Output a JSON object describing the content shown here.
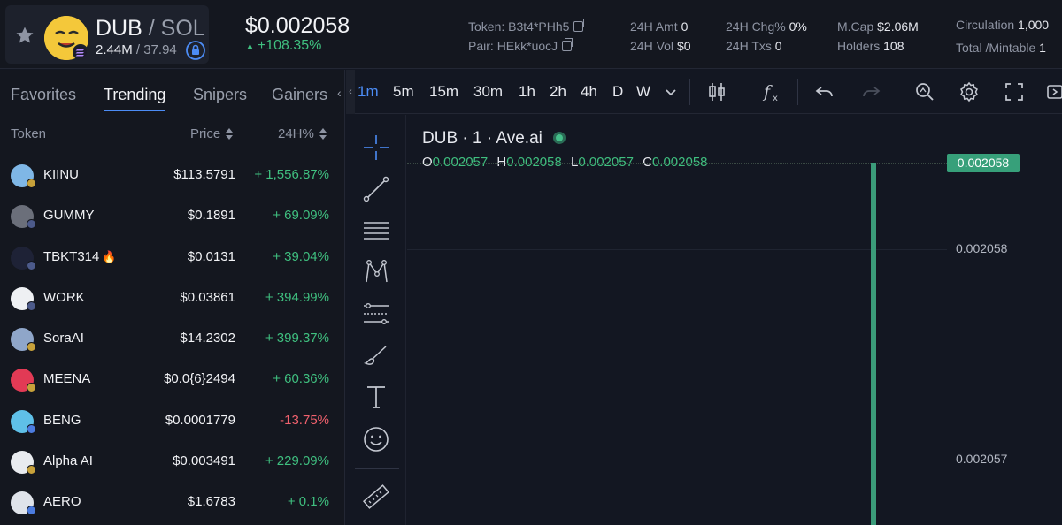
{
  "header": {
    "pair_base": "DUB",
    "pair_sep": " / ",
    "pair_quote": "SOL",
    "liquidity": "2.44M",
    "liquidity_sep": " / ",
    "liquidity_sol": "37.94",
    "price": "$0.002058",
    "change": "+108.35%",
    "token_label": "Token",
    "token_value": "B3t4*PHh5",
    "pair_label": "Pair",
    "pair_value": "HEkk*uocJ",
    "amt_label": "24H Amt",
    "amt_value": "0",
    "vol_label": "24H Vol",
    "vol_value": "$0",
    "chg_label": "24H Chg%",
    "chg_value": "0%",
    "txs_label": "24H Txs",
    "txs_value": "0",
    "mcap_label": "M.Cap",
    "mcap_value": "$2.06M",
    "holders_label": "Holders",
    "holders_value": "108",
    "circ_label": "Circulation",
    "circ_value": "1,000",
    "total_label": "Total /Mintable",
    "total_value": "1",
    "accent": "#3fbf7f"
  },
  "sidebar": {
    "tabs": [
      "Favorites",
      "Trending",
      "Snipers",
      "Gainers"
    ],
    "active_tab": "Trending",
    "columns": {
      "token": "Token",
      "price": "Price",
      "change": "24H%"
    },
    "tokens": [
      {
        "symbol": "KIINU",
        "price": "$113.5791",
        "change": "+ 1,556.87%",
        "dir": "up",
        "color": "#7fb7e6"
      },
      {
        "symbol": "GUMMY",
        "price": "$0.1891",
        "change": "+ 69.09%",
        "dir": "up",
        "color": "#6b6f7a"
      },
      {
        "symbol": "TBKT314",
        "price": "$0.0131",
        "change": "+ 39.04%",
        "dir": "up",
        "color": "#1e2236",
        "fire": "🔥"
      },
      {
        "symbol": "WORK",
        "price": "$0.03861",
        "change": "+ 394.99%",
        "dir": "up",
        "color": "#eef0f3"
      },
      {
        "symbol": "SoraAI",
        "price": "$14.2302",
        "change": "+ 399.37%",
        "dir": "up",
        "color": "#8fa6c9"
      },
      {
        "symbol": "MEENA",
        "price": "$0.0{6}2494",
        "change": "+ 60.36%",
        "dir": "up",
        "color": "#e23a55"
      },
      {
        "symbol": "BENG",
        "price": "$0.0001779",
        "change": "-13.75%",
        "dir": "down",
        "color": "#5fc0e8"
      },
      {
        "symbol": "Alpha AI",
        "price": "$0.003491",
        "change": "+ 229.09%",
        "dir": "up",
        "color": "#e9ebef"
      },
      {
        "symbol": "AERO",
        "price": "$1.6783",
        "change": "+ 0.1%",
        "dir": "up",
        "color": "#dfe3ea"
      }
    ]
  },
  "toolbar": {
    "intervals": [
      "1m",
      "5m",
      "15m",
      "30m",
      "1h",
      "2h",
      "4h",
      "D",
      "W"
    ],
    "active_interval": "1m"
  },
  "chart": {
    "legend": "DUB · 1 · Ave.ai",
    "ohlc": {
      "o_label": "O",
      "o": "0.002057",
      "h_label": "H",
      "h": "0.002058",
      "l_label": "L",
      "l": "0.002057",
      "c_label": "C",
      "c": "0.002058"
    },
    "last_price_tag": "0.002058",
    "axis_labels": [
      "0.002058",
      "0.002057"
    ],
    "up_color": "#3b9c7a"
  },
  "chart_data": {
    "type": "candlestick",
    "title": "DUB · 1 · Ave.ai",
    "interval": "1m",
    "series": [
      {
        "name": "DUB",
        "ohlc": [
          {
            "open": 0.002057,
            "high": 0.002058,
            "low": 0.002057,
            "close": 0.002058
          }
        ]
      }
    ],
    "y_ticks": [
      0.002058,
      0.002057
    ],
    "last_price": 0.002058
  }
}
